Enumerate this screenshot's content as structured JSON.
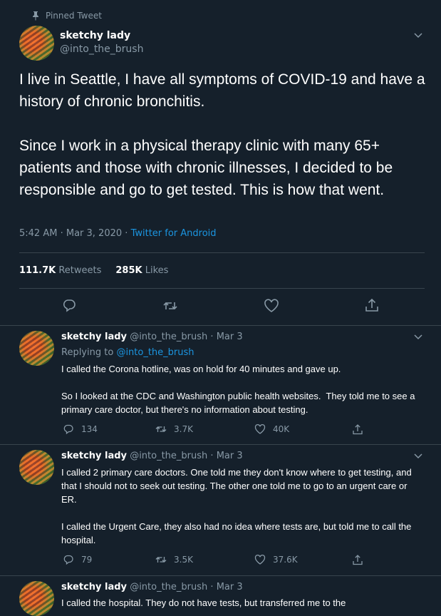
{
  "pinned": {
    "label": "Pinned Tweet"
  },
  "tweet": {
    "name": "sketchy lady",
    "handle": "@into_the_brush",
    "text": "I live in Seattle, I have all symptoms of COVID-19 and have a history of chronic bronchitis.\n\nSince I work in a physical therapy clinic with many 65+ patients and those with chronic illnesses, I decided to be responsible and go to get tested. This is how that went.",
    "time": "5:42 AM",
    "date": "Mar 3, 2020",
    "source": "Twitter for Android",
    "retweets_count": "111.7K",
    "retweets_label": "Retweets",
    "likes_count": "285K",
    "likes_label": "Likes"
  },
  "replies": [
    {
      "name": "sketchy lady",
      "handle": "@into_the_brush",
      "date": "Mar 3",
      "replying_prefix": "Replying to",
      "replying_to": "@into_the_brush",
      "text": "I called the Corona hotline, was on hold for 40 minutes and gave up.\n\nSo I looked at the CDC and Washington public health websites.  They told me to see a primary care doctor, but there's no information about testing.",
      "replies": "134",
      "retweets": "3.7K",
      "likes": "40K"
    },
    {
      "name": "sketchy lady",
      "handle": "@into_the_brush",
      "date": "Mar 3",
      "text": "I called 2 primary care doctors. One told me they don't know where to get testing, and that I should not to seek out testing. The other one told me to go to an urgent care or ER.\n\nI called the Urgent Care, they also had no idea where tests are, but told me to call the hospital.",
      "replies": "79",
      "retweets": "3.5K",
      "likes": "37.6K"
    },
    {
      "name": "sketchy lady",
      "handle": "@into_the_brush",
      "date": "Mar 3",
      "text": "I called the hospital. They do not have tests, but transferred me to the"
    }
  ],
  "separator": "·",
  "colors": {
    "background": "#15202b",
    "muted": "#8899a6",
    "link": "#1b95e0",
    "divider": "#38444d"
  }
}
